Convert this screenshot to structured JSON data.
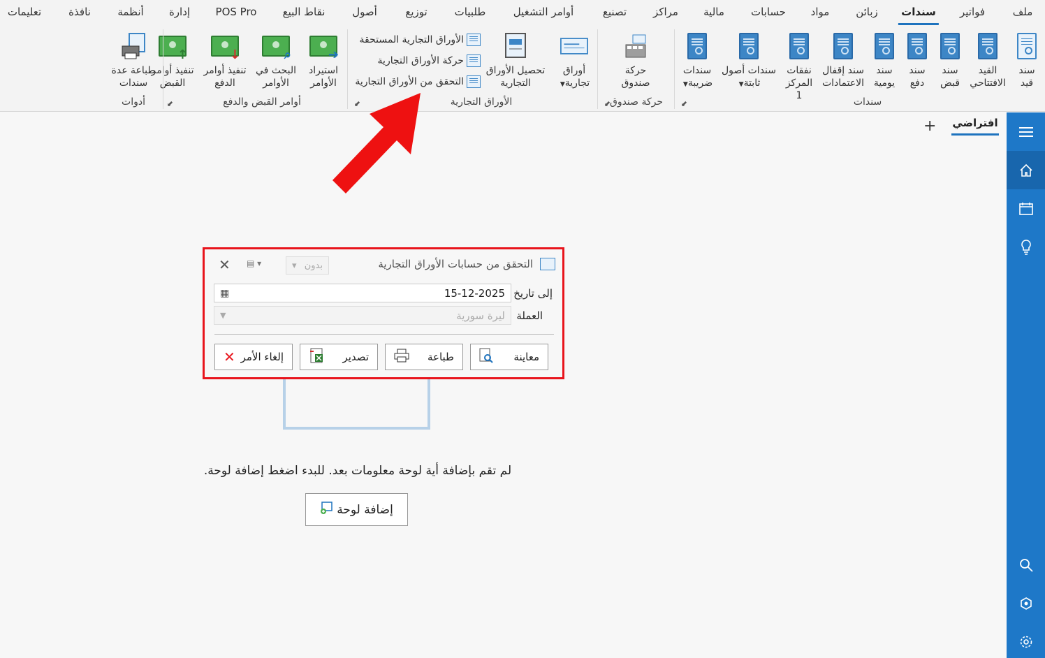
{
  "menu": [
    {
      "label": "ملف"
    },
    {
      "label": "فواتير"
    },
    {
      "label": "سندات",
      "active": true
    },
    {
      "label": "زبائن"
    },
    {
      "label": "مواد"
    },
    {
      "label": "حسابات"
    },
    {
      "label": "مالية"
    },
    {
      "label": "مراكز"
    },
    {
      "label": "تصنيع"
    },
    {
      "label": "أوامر التشغيل"
    },
    {
      "label": "طلبيات"
    },
    {
      "label": "توزيع"
    },
    {
      "label": "أصول"
    },
    {
      "label": "نقاط البيع"
    },
    {
      "label": "POS Pro"
    },
    {
      "label": "إدارة"
    },
    {
      "label": "أنظمة"
    },
    {
      "label": "نافذة"
    },
    {
      "label": "تعليمات"
    }
  ],
  "ribbon": {
    "vouchers": {
      "group_label": "سندات",
      "buttons": [
        {
          "label": "سند\nقيد",
          "icon": "document-icon"
        },
        {
          "label": "القيد\nالافتتاحي",
          "icon": "document-icon"
        },
        {
          "label": "سند\nقبض",
          "icon": "document-icon"
        },
        {
          "label": "سند\nدفع",
          "icon": "document-icon"
        },
        {
          "label": "سند\nيومية",
          "icon": "document-icon"
        },
        {
          "label": "سند إقفال\nالاعتمادات",
          "icon": "document-icon"
        },
        {
          "label": "نفقات\nالمركز 1",
          "icon": "document-icon"
        },
        {
          "label": "سندات أصول\nثابتة",
          "icon": "document-icon"
        },
        {
          "label": "سندات\nضريبة",
          "icon": "document-icon"
        }
      ]
    },
    "cashbox": {
      "group_label": "حركة صندوق",
      "button_label": "حركة\nصندوق"
    },
    "commercial_papers": {
      "group_label": "الأوراق التجارية",
      "papers_label": "أوراق\nتجارية",
      "collect_label": "تحصيل الأوراق\nالتجارية",
      "small": [
        "الأوراق التجارية المستحقة",
        "حركة الأوراق التجارية",
        "التحقق من الأوراق التجارية"
      ]
    },
    "orders": {
      "group_label": "أوامر القبض والدفع",
      "buttons": [
        {
          "label": "استيراد\nالأوامر"
        },
        {
          "label": "البحث في\nالأوامر"
        },
        {
          "label": "تنفيذ أوامر\nالدفع"
        },
        {
          "label": "تنفيذ أوامر\nالقبض"
        }
      ]
    },
    "tools": {
      "group_label": "أدوات",
      "print_label": "طباعة عدة\nسندات"
    }
  },
  "tabs": {
    "default_label": "افتراضي",
    "plus": "+"
  },
  "empty_state": {
    "message": "لم تقم بإضافة أية لوحة معلومات بعد. للبدء اضغط إضافة لوحة.",
    "add_button": "إضافة لوحة"
  },
  "dialog": {
    "title": "التحقق من حسابات الأوراق التجارية",
    "none_select": "بدون",
    "to_date_label": "إلى تاريخ",
    "to_date_value": "15-12-2025",
    "currency_label": "العملة",
    "currency_value": "ليرة سورية",
    "buttons": {
      "preview": "معاينة",
      "print": "طباعة",
      "export": "تصدير",
      "cancel": "إلغاء الأمر"
    }
  },
  "colors": {
    "accent": "#1e73be",
    "sidebar": "#1e78c8",
    "highlight": "#e8141c"
  }
}
